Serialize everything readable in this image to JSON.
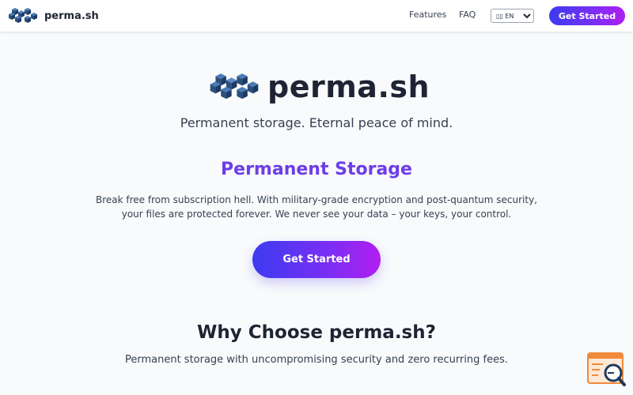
{
  "nav": {
    "brand": "perma.sh",
    "links": [
      "Features",
      "FAQ"
    ],
    "language": "▯▯ EN",
    "cta": "Get Started"
  },
  "hero": {
    "brand": "perma.sh",
    "tagline": "Permanent storage. Eternal peace of mind.",
    "section_title": "Permanent Storage",
    "description": "Break free from subscription hell. With military-grade encryption and post-quantum security, your files are protected forever. We never see your data – your keys, your control.",
    "cta": "Get Started"
  },
  "why": {
    "title": "Why Choose perma.sh?",
    "subtitle": "Permanent storage with uncompromising security and zero recurring fees."
  },
  "colors": {
    "accent_purple": "#6d3de8",
    "gradient_start": "#3b3bf0",
    "gradient_end": "#b01ef0",
    "text_dark": "#1e2433",
    "widget_orange": "#f08a3a"
  },
  "icons": {
    "logo": "cube-cluster-logo-icon",
    "widget": "search-window-icon",
    "select": "chevron-down-icon"
  }
}
